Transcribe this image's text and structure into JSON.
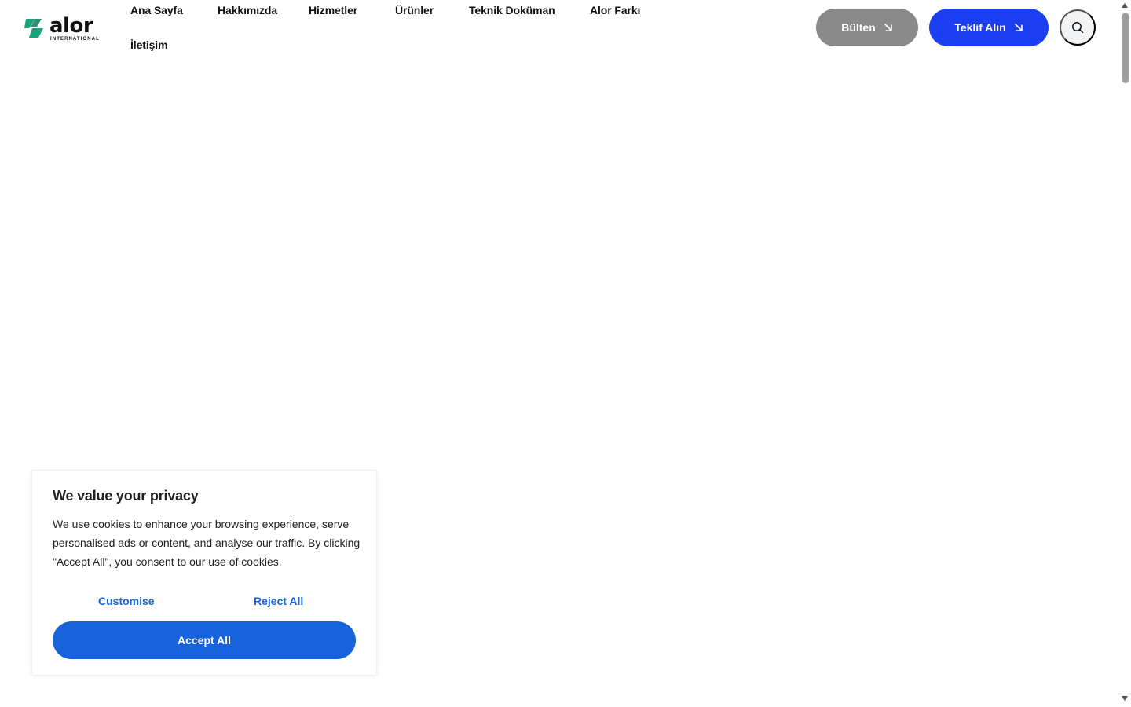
{
  "brand": {
    "name": "alor",
    "subtitle": "INTERNATIONAL",
    "logo_color": "#1aa37a"
  },
  "nav": {
    "items": [
      {
        "label": "Ana Sayfa"
      },
      {
        "label": "Hakkımızda"
      },
      {
        "label": "Hizmetler"
      },
      {
        "label": "Ürünler"
      },
      {
        "label": "Teknik Doküman"
      },
      {
        "label": "Alor Farkı"
      },
      {
        "label": "İletişim"
      }
    ]
  },
  "actions": {
    "bulten_label": "Bülten",
    "teklif_label": "Teklif Alın",
    "search_icon": "search-icon",
    "arrow_icon": "arrow-down-right-icon",
    "bulten_color": "#8a8a8a",
    "teklif_color": "#1a3ef0"
  },
  "cookie": {
    "title": "We value your privacy",
    "text": "We use cookies to enhance your browsing experience, serve personalised ads or content, and analyse our traffic. By clicking \"Accept All\", you consent to our use of cookies.",
    "customise_label": "Customise",
    "reject_label": "Reject All",
    "accept_label": "Accept All",
    "accent_color": "#1863dc"
  }
}
